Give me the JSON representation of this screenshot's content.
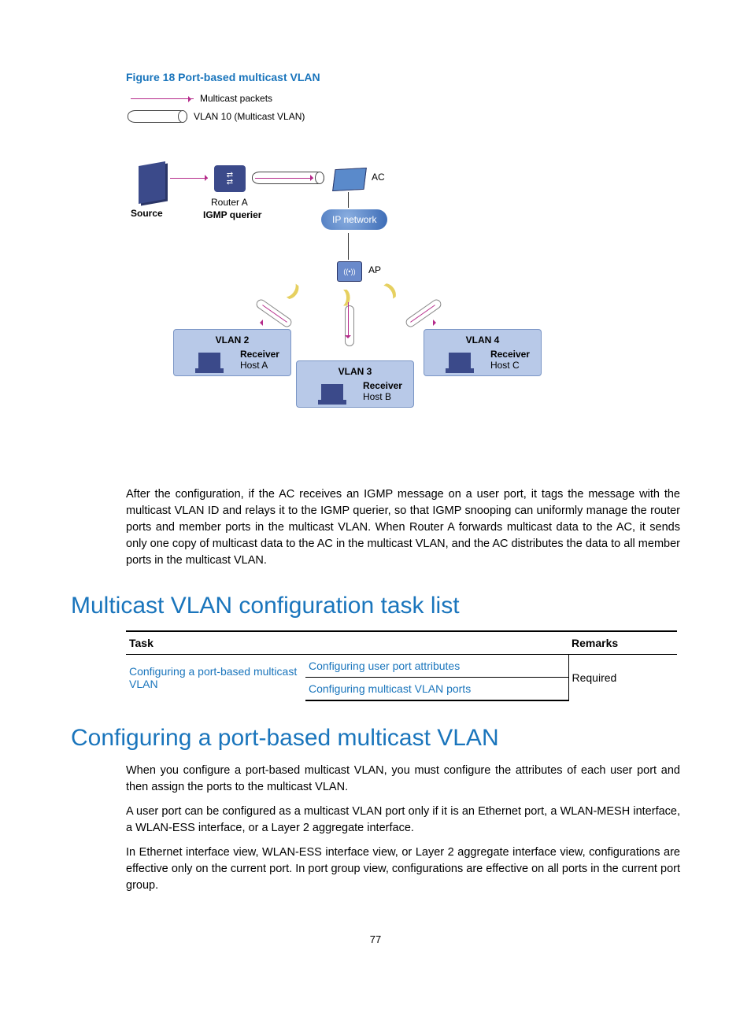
{
  "figure": {
    "caption": "Figure 18 Port-based multicast VLAN",
    "legend_packets": "Multicast packets",
    "legend_vlan": "VLAN 10 (Multicast VLAN)",
    "source": "Source",
    "routerA": "Router A",
    "igmp": "IGMP querier",
    "ac": "AC",
    "ip_network": "IP network",
    "ap": "AP",
    "vlan2": "VLAN 2",
    "vlan3": "VLAN 3",
    "vlan4": "VLAN 4",
    "receiver": "Receiver",
    "hostA": "Host A",
    "hostB": "Host B",
    "hostC": "Host C"
  },
  "body_para": "After the configuration, if the AC receives an IGMP message on a user port, it tags the message with the multicast VLAN ID and relays it to the IGMP querier, so that IGMP snooping can uniformly manage the router ports and member ports in the multicast VLAN. When Router A forwards multicast data to the AC, it sends only one copy of multicast data to the AC in the multicast VLAN, and the AC distributes the data to all member ports in the multicast VLAN.",
  "heading1": "Multicast VLAN configuration task list",
  "table": {
    "col_task": "Task",
    "col_remarks": "Remarks",
    "row1_task": "Configuring a port-based multicast VLAN",
    "row1_sub1": "Configuring user port attributes",
    "row1_sub2": "Configuring multicast VLAN ports",
    "row1_remarks": "Required"
  },
  "heading2": "Configuring a port-based multicast VLAN",
  "para1": "When you configure a port-based multicast VLAN, you must configure the attributes of each user port and then assign the ports to the multicast VLAN.",
  "para2": "A user port can be configured as a multicast VLAN port only if it is an Ethernet port, a WLAN-MESH interface, a WLAN-ESS interface, or a Layer 2 aggregate interface.",
  "para3": "In Ethernet interface view, WLAN-ESS interface view, or Layer 2 aggregate interface view, configurations are effective only on the current port. In port group view, configurations are effective on all  ports in the current port group.",
  "page_number": "77"
}
